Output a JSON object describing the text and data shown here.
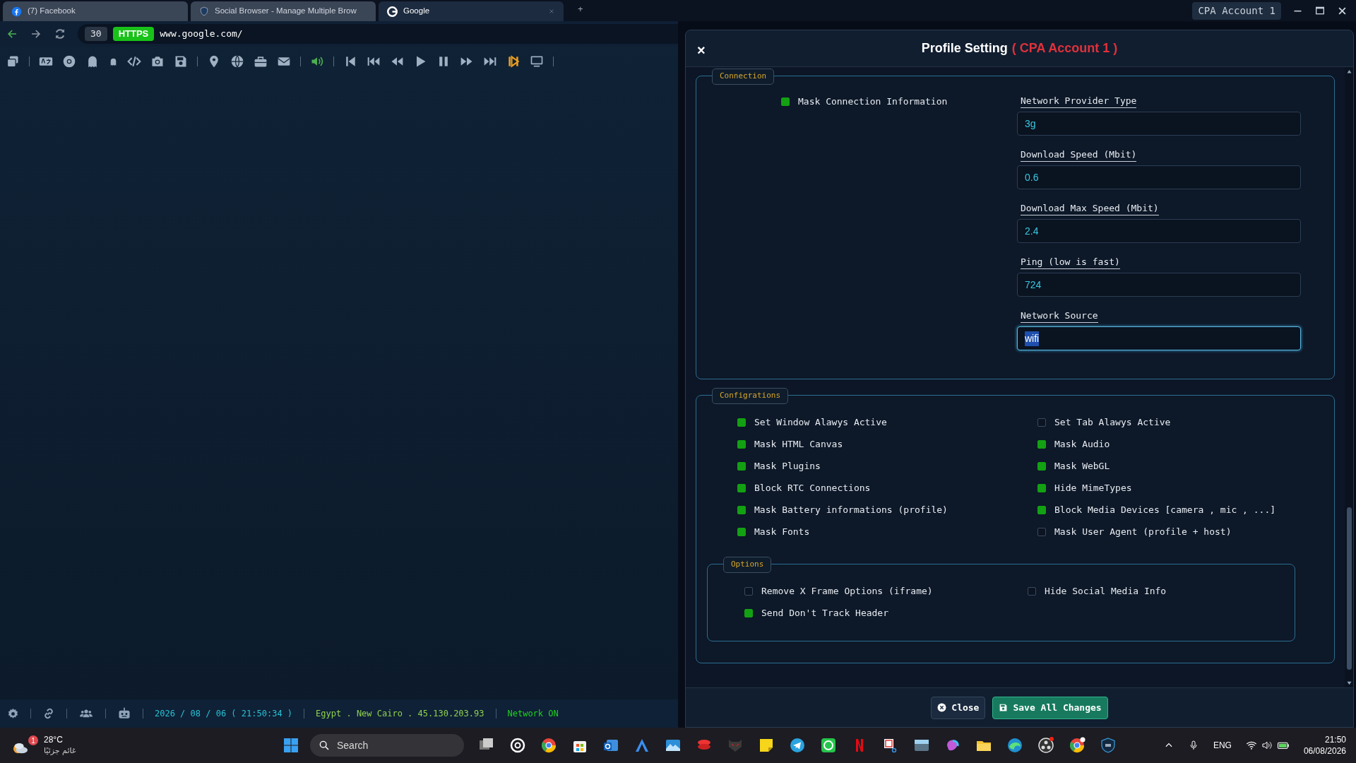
{
  "browser_tabs": [
    {
      "label": "(7) Facebook",
      "selected": false,
      "kind": "facebook"
    },
    {
      "label": "Social Browser - Manage Multiple Brow",
      "selected": false,
      "kind": "social"
    },
    {
      "label": "Google",
      "selected": true,
      "kind": "google"
    }
  ],
  "new_tab": "+",
  "profile_badge": "CPA Account 1",
  "address_bar": {
    "tab_count": "30",
    "protocol": "HTTPS",
    "url": "www.google.com/"
  },
  "dialog": {
    "close": "×",
    "title": "Profile Setting",
    "account": "( CPA Account 1 )",
    "connection": {
      "title": "Connection",
      "toggle": {
        "label": "Mask Connection Information",
        "checked": true
      },
      "fields": [
        {
          "label": "Network Provider Type",
          "value": "3g",
          "focused": false
        },
        {
          "label": "Download Speed (Mbit)",
          "value": "0.6",
          "focused": false
        },
        {
          "label": "Download Max Speed (Mbit)",
          "value": "2.4",
          "focused": false
        },
        {
          "label": "Ping (low is fast)",
          "value": "724",
          "focused": false
        },
        {
          "label": "Network Source",
          "value": "wifi",
          "focused": true
        }
      ]
    },
    "configurations": {
      "title": "Configrations",
      "options": [
        {
          "label": "Set Window Alawys Active",
          "checked": true
        },
        {
          "label": "Set Tab Alawys Active",
          "checked": false
        },
        {
          "label": "Mask HTML Canvas",
          "checked": true
        },
        {
          "label": "Mask Audio",
          "checked": true
        },
        {
          "label": "Mask Plugins",
          "checked": true
        },
        {
          "label": "Mask WebGL",
          "checked": true
        },
        {
          "label": "Block RTC Connections",
          "checked": true
        },
        {
          "label": "Hide MimeTypes",
          "checked": true
        },
        {
          "label": "Mask Battery informations (profile)",
          "checked": true
        },
        {
          "label": "Block Media Devices [camera , mic , ...]",
          "checked": true
        },
        {
          "label": "Mask Fonts",
          "checked": true
        },
        {
          "label": "Mask User Agent (profile + host)",
          "checked": false
        }
      ],
      "subsection": {
        "title": "Options",
        "options": [
          {
            "label": "Remove X Frame Options (iframe)",
            "checked": false
          },
          {
            "label": "Hide Social Media Info",
            "checked": false
          },
          {
            "label": "Send Don't Track Header",
            "checked": true
          }
        ]
      }
    },
    "buttons": [
      {
        "label": "Close",
        "kind": "close"
      },
      {
        "label": "Save All Changes",
        "kind": "save"
      }
    ]
  },
  "status_bar": {
    "datetime": "2026 / 08 / 06 ( 21:50:34 )",
    "location": "Egypt . New Cairo . 45.130.203.93",
    "network": "Network ON"
  },
  "taskbar": {
    "notification_count": "1",
    "temperature": "28°C",
    "weather": "غائم جزئيًا",
    "search_placeholder": "Search",
    "language": "ENG",
    "time": "21:50",
    "date": "06/08/2026"
  }
}
